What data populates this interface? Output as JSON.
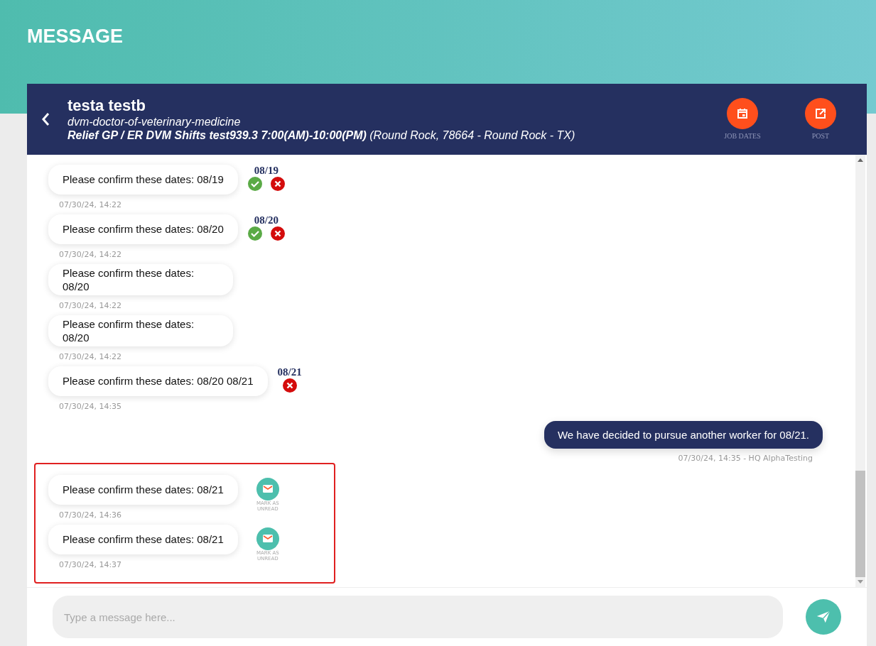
{
  "page_title": "MESSAGE",
  "conversation": {
    "name": "testa testb",
    "role": "dvm-doctor-of-veterinary-medicine",
    "job_title": "Relief GP / ER DVM Shifts test939.3 7:00(AM)-10:00(PM)",
    "job_location": "(Round Rock, 78664 - Round Rock - TX)"
  },
  "header_actions": [
    {
      "kind": "calendar",
      "label": "JOB DATES"
    },
    {
      "kind": "post",
      "label": "POST"
    }
  ],
  "messages": [
    {
      "kind": "received",
      "text": "Please confirm these dates: 08/19",
      "time": "07/30/24, 14:22",
      "narrow": false,
      "actions": {
        "date": "08/19",
        "accept": true,
        "reject": true
      }
    },
    {
      "kind": "received",
      "text": "Please confirm these dates: 08/20",
      "time": "07/30/24, 14:22",
      "narrow": false,
      "actions": {
        "date": "08/20",
        "accept": true,
        "reject": true
      }
    },
    {
      "kind": "received",
      "text": "Please confirm these dates: 08/20",
      "time": "07/30/24, 14:22",
      "narrow": true
    },
    {
      "kind": "received",
      "text": "Please confirm these dates: 08/20",
      "time": "07/30/24, 14:22",
      "narrow": true
    },
    {
      "kind": "received",
      "text": "Please confirm these dates: 08/20 08/21",
      "time": "07/30/24, 14:35",
      "narrow": false,
      "actions": {
        "date": "08/21",
        "accept": false,
        "reject": true
      }
    },
    {
      "kind": "sent",
      "text": "We have decided to pursue another worker for 08/21.",
      "time": "07/30/24, 14:35 - HQ AlphaTesting"
    }
  ],
  "highlighted_messages": [
    {
      "kind": "received",
      "text": "Please confirm these dates: 08/21",
      "time": "07/30/24, 14:36",
      "narrow": false,
      "mark_unread": "MARK AS UNREAD"
    },
    {
      "kind": "received",
      "text": "Please confirm these dates: 08/21",
      "time": "07/30/24, 14:37",
      "narrow": false,
      "mark_unread": "MARK AS UNREAD"
    }
  ],
  "composer": {
    "placeholder": "Type a message here..."
  }
}
